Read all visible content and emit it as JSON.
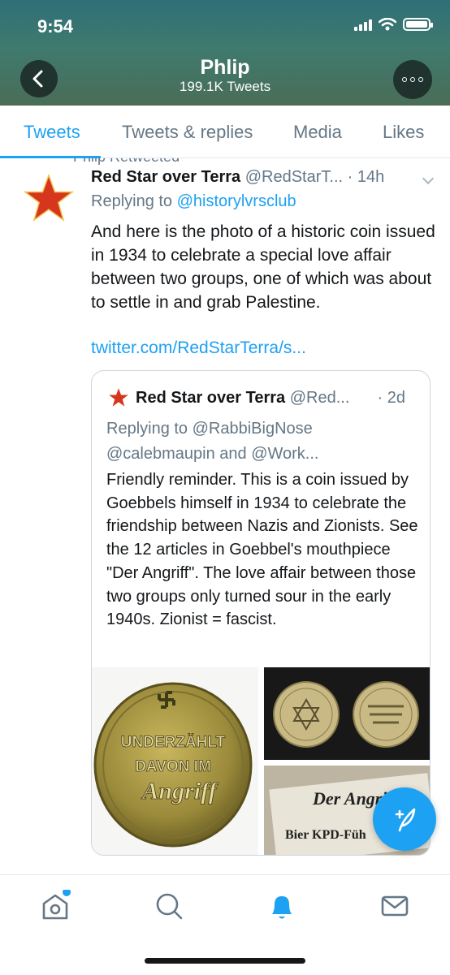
{
  "status": {
    "time": "9:54"
  },
  "header": {
    "title": "Phlip",
    "subtitle": "199.1K Tweets"
  },
  "tabs": [
    {
      "label": "Tweets",
      "active": true
    },
    {
      "label": "Tweets & replies",
      "active": false
    },
    {
      "label": "Media",
      "active": false
    },
    {
      "label": "Likes",
      "active": false
    }
  ],
  "tweet": {
    "retweet_label": "Phlip Retweeted",
    "name": "Red Star over Terra",
    "handle": "@RedStarT...",
    "time": "· 14h",
    "replying_prefix": "Replying to",
    "replying_to": "@historylvrsclub",
    "text": "And here is the photo of a historic coin issued in 1934 to celebrate a special love affair between two groups, one of which was about to settle in and grab Palestine.",
    "link": "twitter.com/RedStarTerra/s..."
  },
  "quoted": {
    "name": "Red Star over Terra",
    "handle": "@Red...",
    "time": "· 2d",
    "replying_line1": "Replying to @RabbiBigNose",
    "replying_line2": "@calebmaupin and @Work...",
    "text": "Friendly reminder. This is a coin issued by Goebbels himself in 1934 to celebrate the friendship between Nazis and Zionists. See the 12 articles in Goebbel's mouthpiece \"Der Angriff\". The love affair between those two groups only turned sour in the early 1940s. Zionist = fascist.",
    "image_texts": {
      "coin_line1": "UNDERZÄHLT",
      "coin_line2": "DAVON IM",
      "coin_line3": "Angriff",
      "paper_title": "Der Angriff",
      "paper_sub": "Bier KPD-Füh"
    }
  },
  "colors": {
    "accent": "#1da1f2",
    "text": "#14171a",
    "muted": "#657786",
    "star": "#d6361d",
    "notification_dot": "#1da1f2"
  }
}
